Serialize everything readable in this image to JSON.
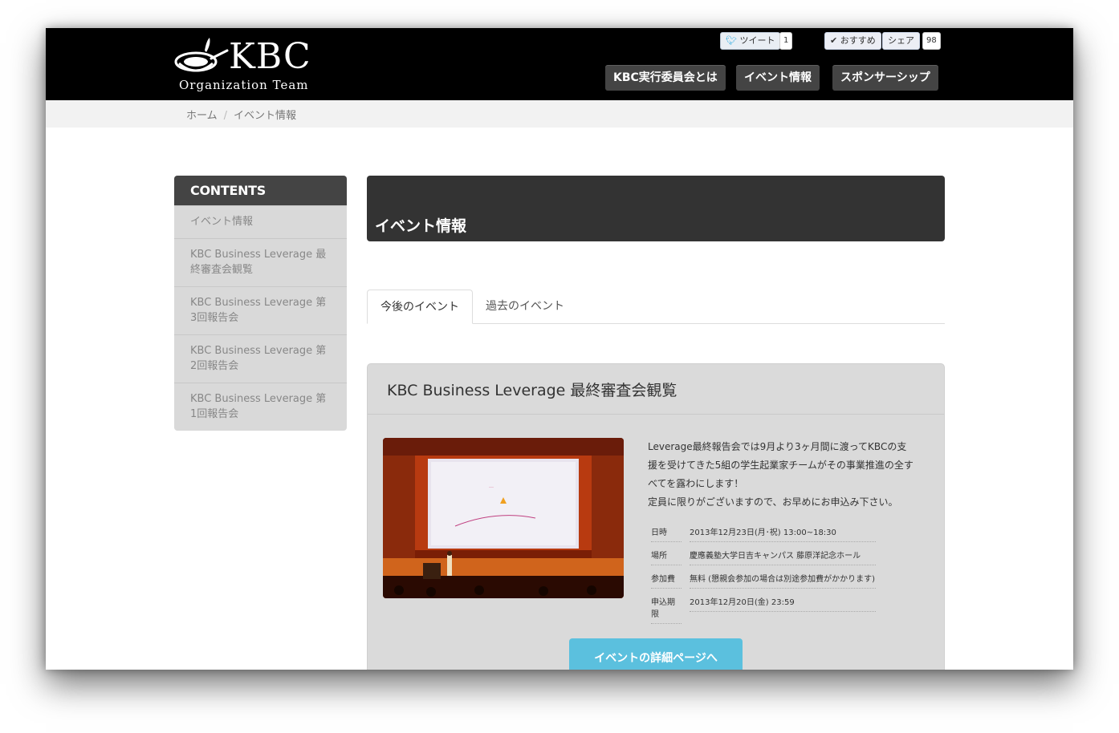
{
  "logo": {
    "word": "KBC",
    "sub": "Organization Team"
  },
  "social": {
    "tweet_label": "ツイート",
    "tweet_count": "1",
    "recommend_label": "おすすめ",
    "share_label": "シェア",
    "share_count": "98"
  },
  "nav": {
    "items": [
      "KBC実行委員会とは",
      "イベント情報",
      "スポンサーシップ"
    ]
  },
  "breadcrumb": {
    "home": "ホーム",
    "separator": "/",
    "current": "イベント情報"
  },
  "sidebar": {
    "heading": "CONTENTS",
    "items": [
      "イベント情報",
      "KBC Business Leverage 最終審査会観覧",
      "KBC Business Leverage 第3回報告会",
      "KBC Business Leverage 第2回報告会",
      "KBC Business Leverage 第1回報告会"
    ]
  },
  "main": {
    "title": "イベント情報",
    "tabs": [
      "今後のイベント",
      "過去のイベント"
    ]
  },
  "event": {
    "title": "KBC Business Leverage 最終審査会観覧",
    "desc_lines": [
      "Leverage最終報告会では9月より3ヶ月間に渡ってKBCの支",
      "援を受けてきた5組の学生起業家チームがその事業推進の全す",
      "べてを露わにします！",
      "定員に限りがございますので、お早めにお申込み下さい。"
    ],
    "info": [
      {
        "key": "日時",
        "value": "2013年12月23日(月･祝) 13:00~18:30"
      },
      {
        "key": "場所",
        "value": "慶應義塾大学日吉キャンパス 藤原洋記念ホール"
      },
      {
        "key": "参加費",
        "value": "無料 (懇親会参加の場合は別途参加費がかかります)"
      },
      {
        "key": "申込期限",
        "value": "2013年12月20日(金) 23:59"
      }
    ],
    "detail_button": "イベントの詳細ページへ"
  },
  "colors": {
    "header": "#000000",
    "sidebar_head": "#444444",
    "button_accent": "#5bc0de"
  }
}
